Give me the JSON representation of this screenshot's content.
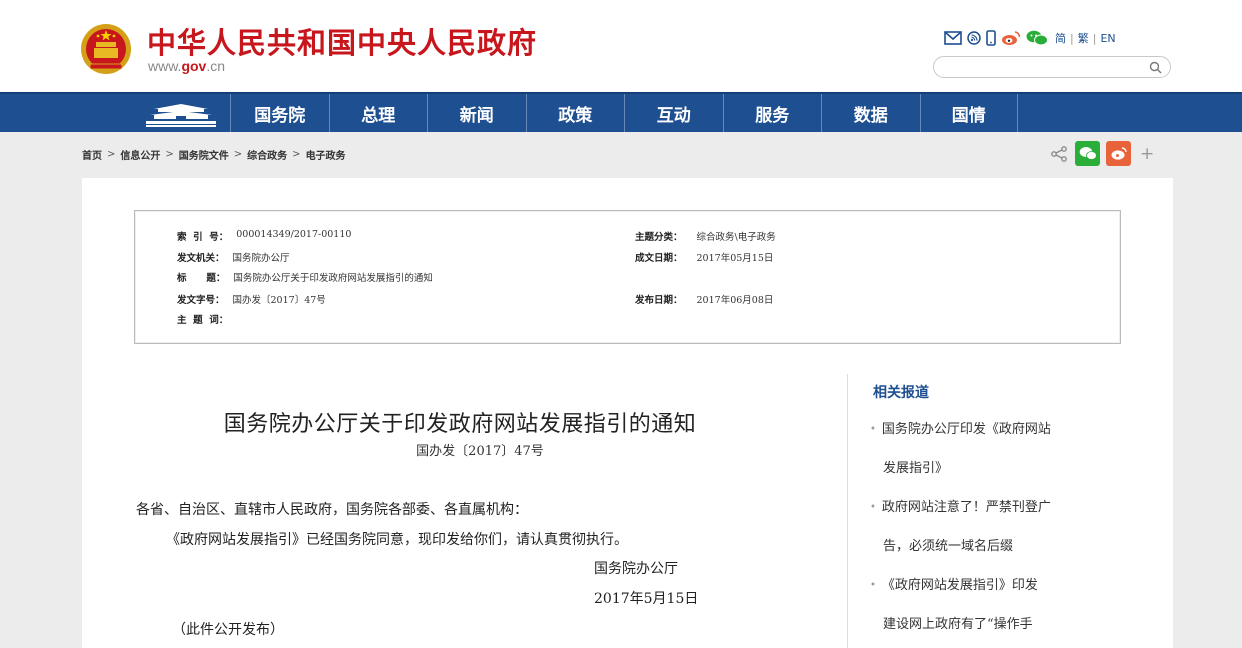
{
  "header": {
    "title": "中华人民共和国中央人民政府",
    "domain_prefix": "www.",
    "domain_main": "gov",
    "domain_suffix": ".cn",
    "icons": [
      "mail-icon",
      "rss-icon",
      "mobile-icon",
      "weibo-icon",
      "wechat-icon"
    ],
    "lang_simplified": "简",
    "lang_traditional": "繁",
    "lang_english": "EN",
    "search_placeholder": ""
  },
  "nav": {
    "items": [
      "国务院",
      "总理",
      "新闻",
      "政策",
      "互动",
      "服务",
      "数据",
      "国情"
    ]
  },
  "breadcrumb": [
    "首页",
    "信息公开",
    "国务院文件",
    "综合政务",
    "电子政务"
  ],
  "meta": {
    "index_label": "索  引  号：",
    "index_value": "000014349/2017-00110",
    "category_label": "主题分类：",
    "category_value": "综合政务\\电子政务",
    "issuer_label": "发文机关：",
    "issuer_value": "国务院办公厅",
    "created_label": "成文日期：",
    "created_value": "2017年05月15日",
    "title_label": "标      题：",
    "title_value": "国务院办公厅关于印发政府网站发展指引的通知",
    "docno_label": "发文字号：",
    "docno_value": "国办发〔2017〕47号",
    "published_label": "发布日期：",
    "published_value": "2017年06月08日",
    "keywords_label": "主  题  词：",
    "keywords_value": ""
  },
  "article": {
    "title": "国务院办公厅关于印发政府网站发展指引的通知",
    "doc_number": "国办发〔2017〕47号",
    "salutation": "各省、自治区、直辖市人民政府，国务院各部委、各直属机构：",
    "body": "《政府网站发展指引》已经国务院同意，现印发给你们，请认真贯彻执行。",
    "signature": "国务院办公厅",
    "date": "2017年5月15日",
    "note": "（此件公开发布）"
  },
  "related": {
    "title": "相关报道",
    "items": [
      {
        "line1": "国务院办公厅印发《政府网站",
        "line2": "发展指引》"
      },
      {
        "line1": "政府网站注意了！严禁刊登广",
        "line2": "告，必须统一域名后缀"
      },
      {
        "line1": "《政府网站发展指引》印发",
        "line2": "建设网上政府有了“操作手"
      }
    ]
  },
  "colors": {
    "brand_red": "#c8161d",
    "nav_blue": "#1d4f91",
    "wechat_green": "#2aae3a",
    "weibo_orange": "#e8633a"
  }
}
